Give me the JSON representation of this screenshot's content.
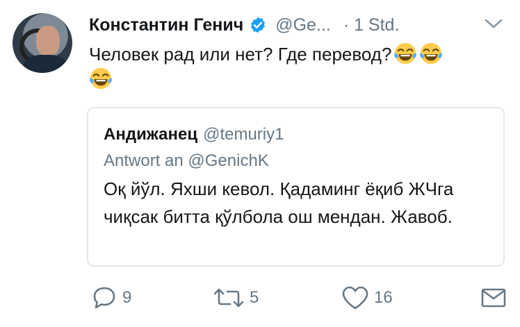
{
  "tweet": {
    "author_name": "Константин Генич",
    "author_handle": "@Ge...",
    "time": "· 1 Std.",
    "text": "Человек рад или нет? Где перевод?",
    "emoji_icon": "face-with-tears-of-joy"
  },
  "quoted": {
    "author_name": "Андижанец",
    "author_handle": "@temuriy1",
    "reply_to": "Antwort an @GenichK",
    "text": "Оқ йўл. Яхши кевол. Қадаминг ёқиб ЖЧга чиқсак битта қўлбола ош мендан. Жавоб."
  },
  "actions": {
    "reply_count": "9",
    "retweet_count": "5",
    "like_count": "16"
  },
  "colors": {
    "verified": "#1da1f2",
    "muted": "#657786",
    "border": "#e1e8ed"
  }
}
